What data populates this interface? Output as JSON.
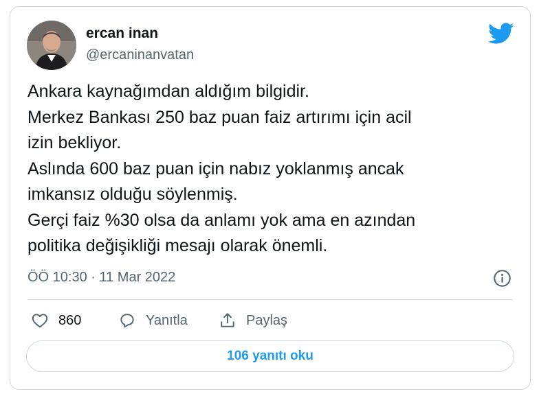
{
  "tweet": {
    "author_name": "ercan inan",
    "author_handle": "@ercaninanvatan",
    "lines": [
      "Ankara kaynağımdan aldığım bilgidir.",
      "Merkez Bankası 250 baz puan faiz artırımı için acil",
      "izin bekliyor.",
      "Aslında 600 baz puan için nabız yoklanmış ancak",
      "imkansız olduğu söylenmiş.",
      "Gerçi faiz %30 olsa da anlamı yok ama en azından",
      "politika değişikliği mesajı olarak önemli."
    ],
    "timestamp": "ÖÖ 10:30 · 11 Mar 2022"
  },
  "actions": {
    "like_count": "860",
    "reply_label": "Yanıtla",
    "share_label": "Paylaş"
  },
  "replies_button_label": "106 yanıtı oku",
  "icons": {
    "brand": "twitter-bird-icon",
    "info": "info-icon",
    "like": "heart-icon",
    "reply": "speech-bubble-icon",
    "share": "share-icon"
  },
  "colors": {
    "accent": "#1d9bf0",
    "text": "#0f1419",
    "secondary_text": "#536471",
    "border": "#cfd9de"
  }
}
